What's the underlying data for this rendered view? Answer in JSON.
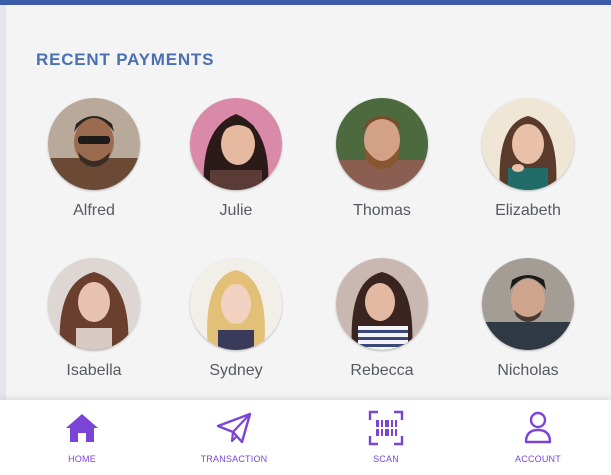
{
  "section": {
    "title": "RECENT PAYMENTS"
  },
  "contacts": [
    {
      "name": "Alfred"
    },
    {
      "name": "Julie"
    },
    {
      "name": "Thomas"
    },
    {
      "name": "Elizabeth"
    },
    {
      "name": "Isabella"
    },
    {
      "name": "Sydney"
    },
    {
      "name": "Rebecca"
    },
    {
      "name": "Nicholas"
    }
  ],
  "nav": {
    "items": [
      {
        "label": "HOME",
        "icon": "home-icon"
      },
      {
        "label": "TRANSACTION",
        "icon": "paper-plane-icon"
      },
      {
        "label": "SCAN",
        "icon": "qr-scan-icon"
      },
      {
        "label": "ACCOUNT",
        "icon": "user-icon"
      }
    ]
  },
  "colors": {
    "accent": "#3b5aa8",
    "title": "#4a70b4",
    "nav_active": "#7a45d6"
  }
}
